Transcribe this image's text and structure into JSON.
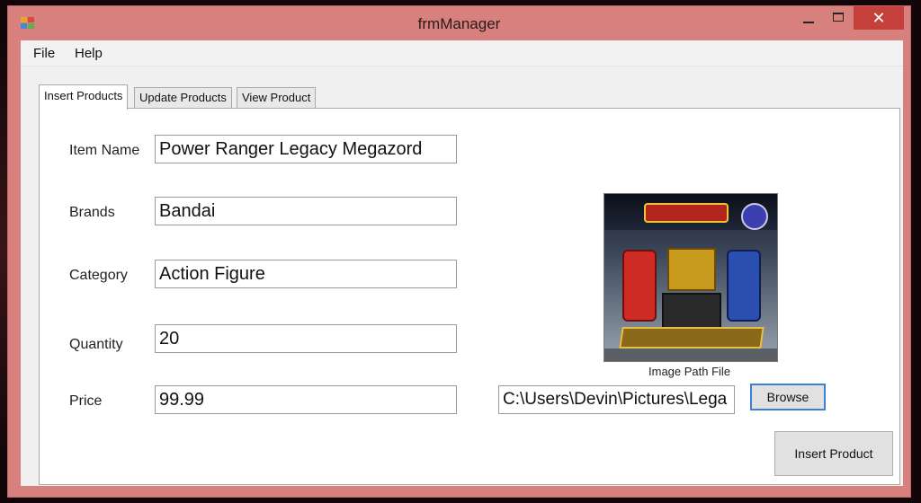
{
  "window": {
    "title": "frmManager",
    "minimize_label": "",
    "maximize_label": "",
    "close_label": "✕",
    "title_color": "#d7807d",
    "close_color": "#c6403b"
  },
  "menu": {
    "items": [
      {
        "label": "File"
      },
      {
        "label": "Help"
      }
    ]
  },
  "tabs": [
    {
      "label": "Insert Products",
      "active": true
    },
    {
      "label": "Update Products",
      "active": false
    },
    {
      "label": "View Product",
      "active": false
    }
  ],
  "form": {
    "item_name": {
      "label": "Item Name",
      "value": "Power Ranger Legacy Megazord"
    },
    "brands": {
      "label": "Brands",
      "value": "Bandai"
    },
    "category": {
      "label": "Category",
      "value": "Action Figure"
    },
    "quantity": {
      "label": "Quantity",
      "value": "20"
    },
    "price": {
      "label": "Price",
      "value": "99.99"
    }
  },
  "image_panel": {
    "image_path_label": "Image Path File",
    "image_path_value": "C:\\Users\\Devin\\Pictures\\Lega",
    "browse_label": "Browse"
  },
  "actions": {
    "insert_label": "Insert Product"
  }
}
